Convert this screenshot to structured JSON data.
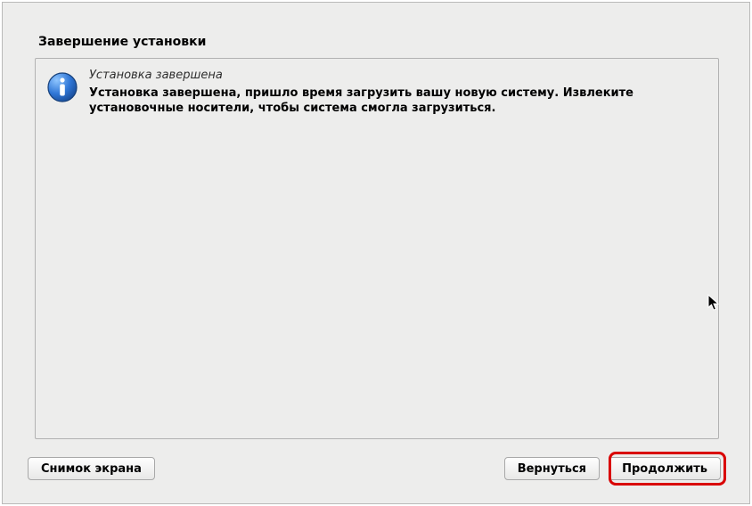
{
  "title": "Завершение установки",
  "info": {
    "heading": "Установка завершена",
    "body": "Установка завершена, пришло время загрузить вашу новую систему. Извлеките установочные носители, чтобы система смогла загрузиться."
  },
  "buttons": {
    "screenshot": "Снимок экрана",
    "back": "Вернуться",
    "continue": "Продолжить"
  }
}
